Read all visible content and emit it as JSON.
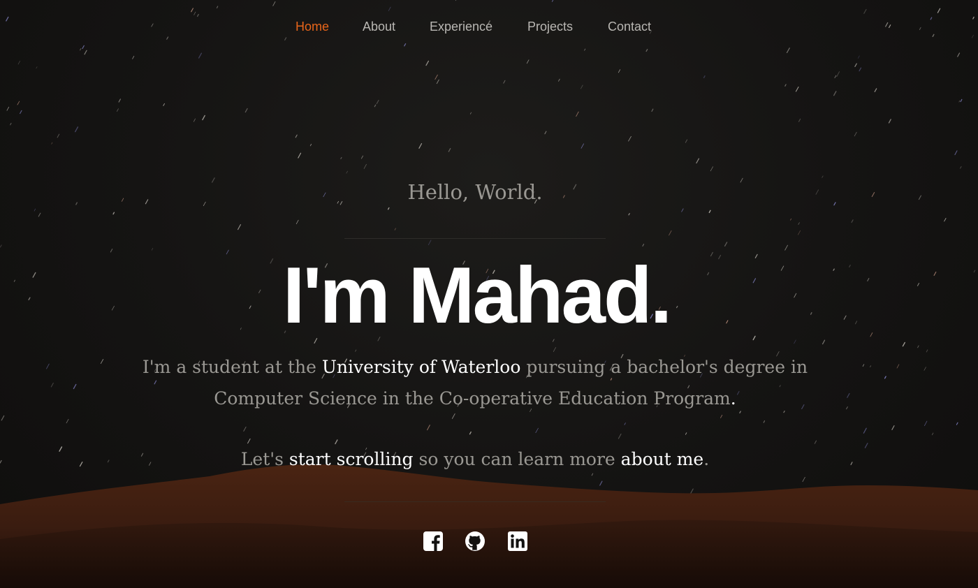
{
  "nav": {
    "items": [
      {
        "label": "Home",
        "active": true
      },
      {
        "label": "About",
        "active": false
      },
      {
        "label": "Experience",
        "active": false
      },
      {
        "label": "Projects",
        "active": false
      },
      {
        "label": "Contact",
        "active": false
      }
    ]
  },
  "hero": {
    "greeting": "Hello, World.",
    "headline": "I'm Mahad.",
    "intro": {
      "part1": "I'm a student at the ",
      "university": "University of Waterloo",
      "part2": " pursuing a bachelor's degree in Computer Science in the Co-operative Education Program",
      "end": "."
    },
    "cta": {
      "part1": "Let's ",
      "scroll_link": "start scrolling",
      "part2": " so you can learn more ",
      "about_link": "about me",
      "end": "."
    }
  },
  "socials": [
    {
      "icon": "facebook-icon"
    },
    {
      "icon": "github-icon"
    },
    {
      "icon": "linkedin-icon"
    }
  ],
  "colors": {
    "accent": "#e8651a",
    "nav_text": "#b9b7b3",
    "muted_text": "#9a9893",
    "highlight_text": "#ffffff",
    "background": "#121110",
    "dune": "#3a1c10"
  }
}
